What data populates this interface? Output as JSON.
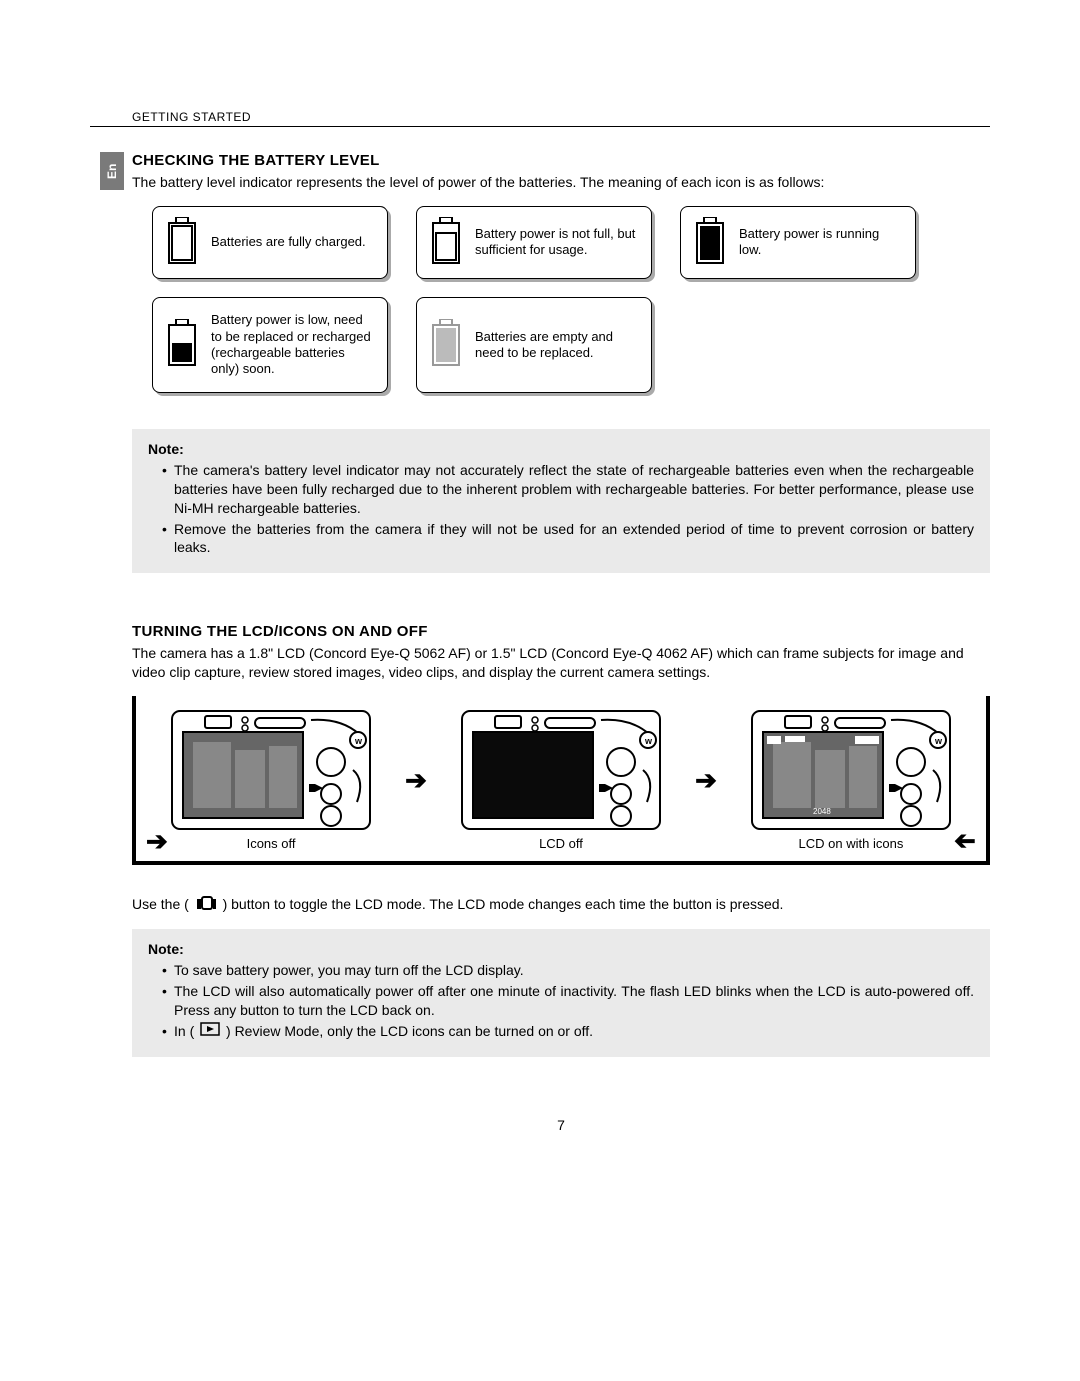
{
  "lang_tab": "En",
  "header": "GETTING STARTED",
  "section1": {
    "title": "CHECKING THE BATTERY LEVEL",
    "intro": "The battery level indicator represents the level of power of the batteries. The meaning of each icon is as follows:",
    "cards": [
      {
        "text": "Batteries are fully charged."
      },
      {
        "text": "Battery power is not full, but sufficient for usage."
      },
      {
        "text": "Battery power is running low."
      },
      {
        "text": "Battery power is low, need to be replaced or recharged (rechargeable batteries only) soon."
      },
      {
        "text": "Batteries are empty and need to be replaced."
      }
    ],
    "note_label": "Note:",
    "notes": [
      "The camera's battery level indicator may not accurately reflect the state of rechargeable batteries even when the rechargeable batteries have been fully recharged due to the inherent problem with rechargeable batteries. For better performance, please use Ni-MH rechargeable batteries.",
      "Remove the batteries from the camera if they will not be used for an extended period of time to prevent corrosion or battery leaks."
    ]
  },
  "section2": {
    "title": "TURNING THE LCD/ICONS ON AND OFF",
    "intro": "The camera has a 1.8\" LCD (Concord Eye-Q 5062 AF) or 1.5\" LCD (Concord Eye-Q 4062 AF) which can frame subjects for image and video clip capture, review stored images, video clips, and display the current camera settings.",
    "panels": [
      {
        "caption": "Icons off"
      },
      {
        "caption": "LCD off"
      },
      {
        "caption": "LCD on with icons"
      }
    ],
    "usage_pre": "Use the (",
    "usage_post": ") button to toggle the LCD mode. The LCD mode changes each time the button is pressed.",
    "note_label": "Note:",
    "notes2_a": "To save battery power, you may turn off the LCD display.",
    "notes2_b": "The LCD will also automatically power off after one minute of inactivity. The flash LED blinks when the LCD is auto-powered off.  Press any button to turn the LCD back on.",
    "notes2_c_pre": "In (",
    "notes2_c_post": ") Review Mode, only the LCD icons can be turned on or off."
  },
  "page_number": "7"
}
